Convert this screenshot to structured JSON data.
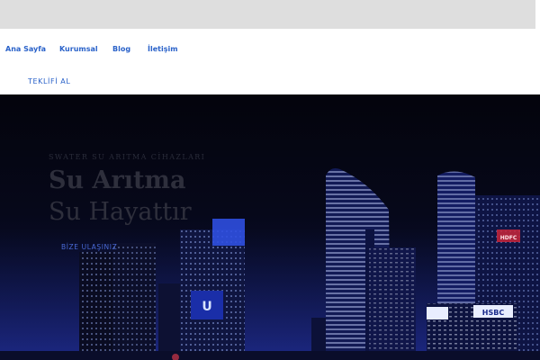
{
  "nav": {
    "items": [
      {
        "label": "Ana Sayfa"
      },
      {
        "label": "Kurumsal"
      },
      {
        "label": "Blog"
      },
      {
        "label": "İletişim"
      }
    ],
    "quote_label": "TEKLİFİ AL"
  },
  "hero": {
    "tagline": "SWATER SU ARITMA CİHAZLARI",
    "title_line1": "Su Arıtma",
    "title_line2": "Su Hayattır",
    "cta_label": "BİZE ULAŞINIZ",
    "sign_left": "U",
    "sign_bank": "HSBC",
    "sign_red": "HDFC"
  },
  "colors": {
    "accent": "#2a62c9",
    "topbar": "#dedede",
    "hero_bg": "#06081a"
  }
}
